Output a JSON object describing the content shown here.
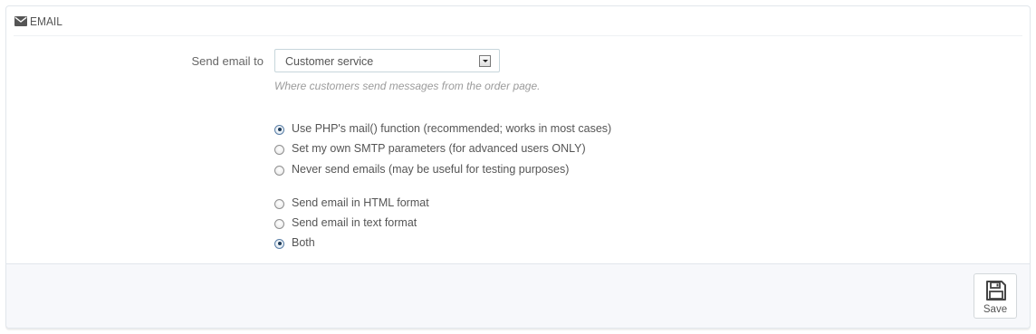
{
  "section": {
    "title": "EMAIL"
  },
  "send_to": {
    "label": "Send email to",
    "selected": "Customer service",
    "help": "Where customers send messages from the order page."
  },
  "method_options": [
    {
      "label": "Use PHP's mail() function (recommended; works in most cases)",
      "checked": true
    },
    {
      "label": "Set my own SMTP parameters (for advanced users ONLY)",
      "checked": false
    },
    {
      "label": "Never send emails (may be useful for testing purposes)",
      "checked": false
    }
  ],
  "format_options": [
    {
      "label": "Send email in HTML format",
      "checked": false
    },
    {
      "label": "Send email in text format",
      "checked": false
    },
    {
      "label": "Both",
      "checked": true
    }
  ],
  "footer": {
    "save_label": "Save"
  },
  "icons": {
    "heading": "envelope-icon",
    "select_arrow": "chevron-down-icon",
    "save": "floppy-disk-icon"
  },
  "colors": {
    "panel_border": "#e1e6eb",
    "footer_bg": "#f7f8fb",
    "help_text": "#9b9b9b"
  }
}
